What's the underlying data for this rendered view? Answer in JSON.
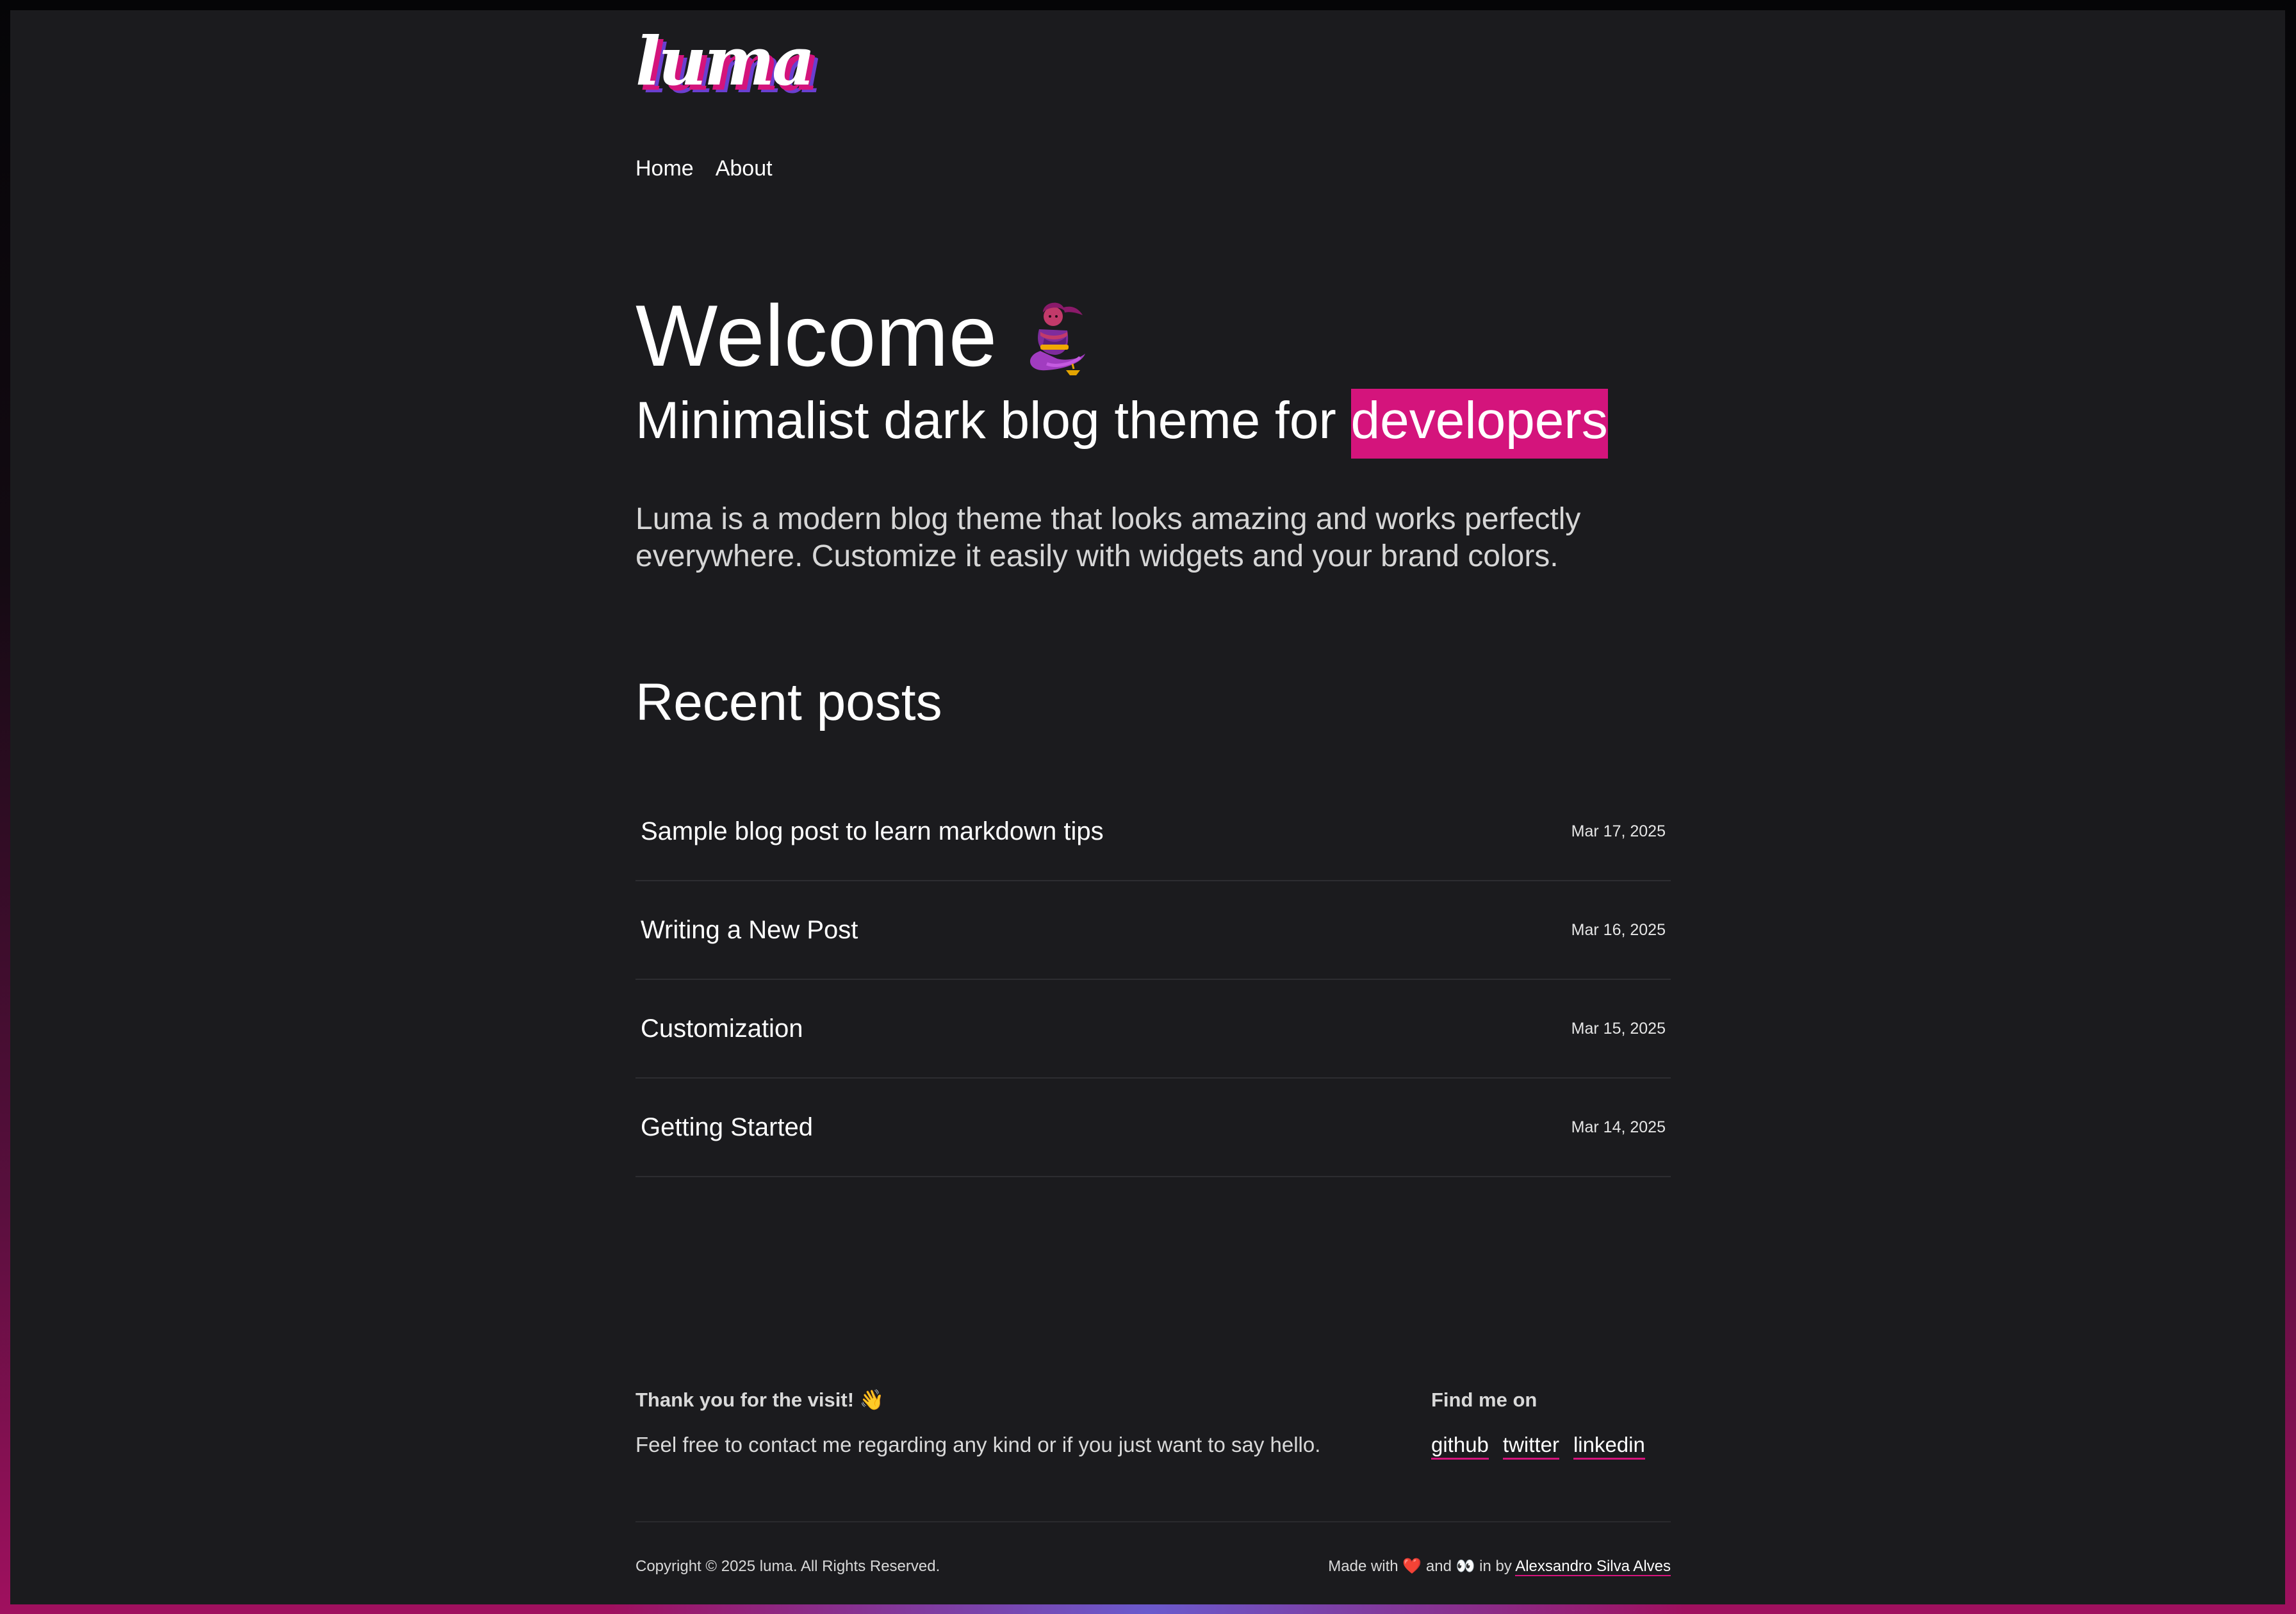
{
  "header": {
    "logo_text": "luma",
    "nav": [
      {
        "label": "Home"
      },
      {
        "label": "About"
      }
    ]
  },
  "hero": {
    "title": "Welcome",
    "title_icon": "genie-icon",
    "subtitle_prefix": "Minimalist dark blog theme for",
    "subtitle_highlight": "developers",
    "description": "Luma is a modern blog theme that looks amazing and works perfectly everywhere. Customize it easily with widgets and your brand colors."
  },
  "recent_posts": {
    "heading": "Recent posts",
    "items": [
      {
        "title": "Sample blog post to learn markdown tips",
        "date": "Mar 17, 2025"
      },
      {
        "title": "Writing a New Post",
        "date": "Mar 16, 2025"
      },
      {
        "title": "Customization",
        "date": "Mar 15, 2025"
      },
      {
        "title": "Getting Started",
        "date": "Mar 14, 2025"
      }
    ]
  },
  "footer": {
    "thanks_heading": "Thank you for the visit! 👋",
    "thanks_text": "Feel free to contact me regarding any kind or if you just want to say hello.",
    "find_heading": "Find me on",
    "social": [
      {
        "label": "github"
      },
      {
        "label": "twitter"
      },
      {
        "label": "linkedin"
      }
    ],
    "copyright": "Copyright © 2025 luma. All Rights Reserved.",
    "made_with_prefix": "Made with",
    "made_with_heart": "❤️",
    "made_with_and": "and",
    "made_with_eyes": "👀",
    "made_with_in_by": "in by",
    "author": "Alexsandro Silva Alves"
  },
  "colors": {
    "accent": "#d4147c",
    "panel_bg": "#1b1b1e",
    "text": "#ffffff",
    "muted_text": "#d6d6d6"
  }
}
